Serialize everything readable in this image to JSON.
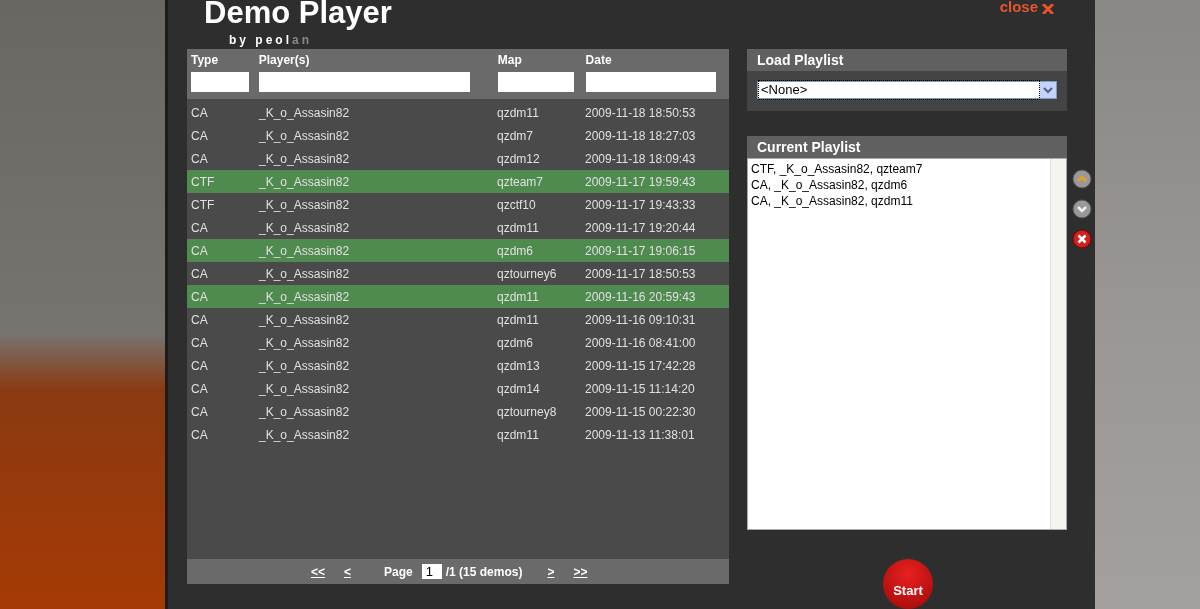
{
  "header": {
    "title": "Demo Player",
    "subtitle": [
      {
        "text": "by peol",
        "dim": false
      },
      {
        "text": "an",
        "dim": true
      }
    ],
    "close": "close"
  },
  "table": {
    "columns": [
      "Type",
      "Player(s)",
      "Map",
      "Date"
    ],
    "rows": [
      {
        "cells": [
          "CA",
          "_K_o_Assasin82",
          "qzdm11",
          "2009-11-18 18:50:53"
        ],
        "selected": false
      },
      {
        "cells": [
          "CA",
          "_K_o_Assasin82",
          "qzdm7",
          "2009-11-18 18:27:03"
        ],
        "selected": false
      },
      {
        "cells": [
          "CA",
          "_K_o_Assasin82",
          "qzdm12",
          "2009-11-18 18:09:43"
        ],
        "selected": false
      },
      {
        "cells": [
          "CTF",
          "_K_o_Assasin82",
          "qzteam7",
          "2009-11-17 19:59:43"
        ],
        "selected": true
      },
      {
        "cells": [
          "CTF",
          "_K_o_Assasin82",
          "qzctf10",
          "2009-11-17 19:43:33"
        ],
        "selected": false
      },
      {
        "cells": [
          "CA",
          "_K_o_Assasin82",
          "qzdm11",
          "2009-11-17 19:20:44"
        ],
        "selected": false
      },
      {
        "cells": [
          "CA",
          "_K_o_Assasin82",
          "qzdm6",
          "2009-11-17 19:06:15"
        ],
        "selected": true
      },
      {
        "cells": [
          "CA",
          "_K_o_Assasin82",
          "qztourney6",
          "2009-11-17 18:50:53"
        ],
        "selected": false
      },
      {
        "cells": [
          "CA",
          "_K_o_Assasin82",
          "qzdm11",
          "2009-11-16 20:59:43"
        ],
        "selected": true
      },
      {
        "cells": [
          "CA",
          "_K_o_Assasin82",
          "qzdm11",
          "2009-11-16 09:10:31"
        ],
        "selected": false
      },
      {
        "cells": [
          "CA",
          "_K_o_Assasin82",
          "qzdm6",
          "2009-11-16 08:41:00"
        ],
        "selected": false
      },
      {
        "cells": [
          "CA",
          "_K_o_Assasin82",
          "qzdm13",
          "2009-11-15 17:42:28"
        ],
        "selected": false
      },
      {
        "cells": [
          "CA",
          "_K_o_Assasin82",
          "qzdm14",
          "2009-11-15 11:14:20"
        ],
        "selected": false
      },
      {
        "cells": [
          "CA",
          "_K_o_Assasin82",
          "qztourney8",
          "2009-11-15 00:22:30"
        ],
        "selected": false
      },
      {
        "cells": [
          "CA",
          "_K_o_Assasin82",
          "qzdm11",
          "2009-11-13 11:38:01"
        ],
        "selected": false
      }
    ]
  },
  "pager": {
    "first": "<<",
    "prev": "<",
    "label": "Page",
    "page": "1",
    "total": "/1 (15 demos)",
    "next": ">",
    "last": ">>"
  },
  "load_playlist": {
    "title": "Load Playlist",
    "value": "<None>"
  },
  "current_playlist": {
    "title": "Current Playlist",
    "items": [
      "CTF, _K_o_Assasin82, qzteam7",
      "CA, _K_o_Assasin82, qzdm6",
      "CA, _K_o_Assasin82, qzdm11"
    ]
  },
  "start": "Start"
}
